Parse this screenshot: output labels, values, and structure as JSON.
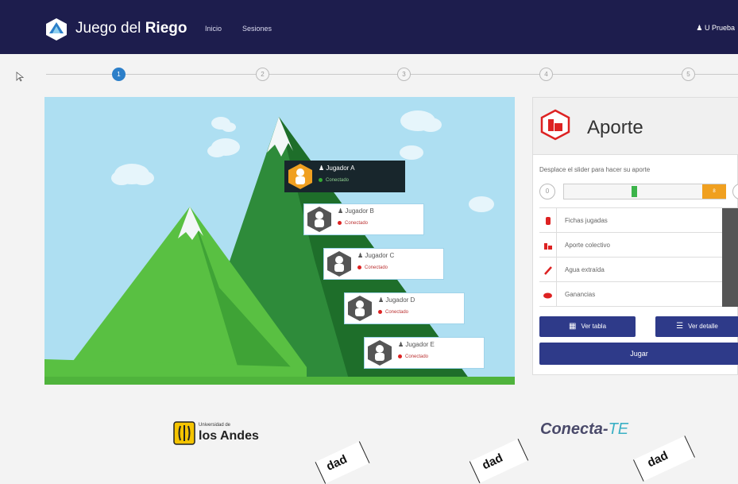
{
  "navbar": {
    "brand_prefix": "Juego del ",
    "brand_bold": "Riego",
    "links": [
      "Inicio",
      "Sesiones"
    ],
    "user": "U Prueba"
  },
  "steps": [
    "1",
    "2",
    "3",
    "4",
    "5"
  ],
  "active_step": 1,
  "players": [
    {
      "name": "Jugador A",
      "status": "Conectado",
      "active": true
    },
    {
      "name": "Jugador B",
      "status": "Conectado",
      "active": false
    },
    {
      "name": "Jugador C",
      "status": "Conectado",
      "active": false
    },
    {
      "name": "Jugador D",
      "status": "Conectado",
      "active": false
    },
    {
      "name": "Jugador E",
      "status": "Conectado",
      "active": false
    }
  ],
  "panel": {
    "title": "Aporte",
    "instruction": "Desplace el slider para hacer su aporte",
    "slider_min": "0",
    "slider_value": "8",
    "rows": [
      {
        "icon": "tokens-icon",
        "label": "Fichas jugadas"
      },
      {
        "icon": "collective-icon",
        "label": "Aporte colectivo"
      },
      {
        "icon": "water-icon",
        "label": "Agua extraída"
      },
      {
        "icon": "earnings-icon",
        "label": "Ganancias"
      }
    ],
    "btn_table": "Ver tabla",
    "btn_detail": "Ver detalle",
    "btn_play": "Jugar"
  },
  "footer": {
    "uni_small": "Universidad de",
    "uni_big": "los Andes",
    "partner": "Conecta-",
    "partner_suffix": "TE"
  },
  "watermarks": [
    "dad",
    "dad",
    "dad"
  ],
  "colors": {
    "navbar": "#1d1d4d",
    "accent": "#2c7fc9",
    "button": "#2e3a89",
    "mountain_dark": "#2e8b3a",
    "mountain_light": "#59c042",
    "sky": "#aedff2",
    "slider_thumb": "#f0a020"
  }
}
